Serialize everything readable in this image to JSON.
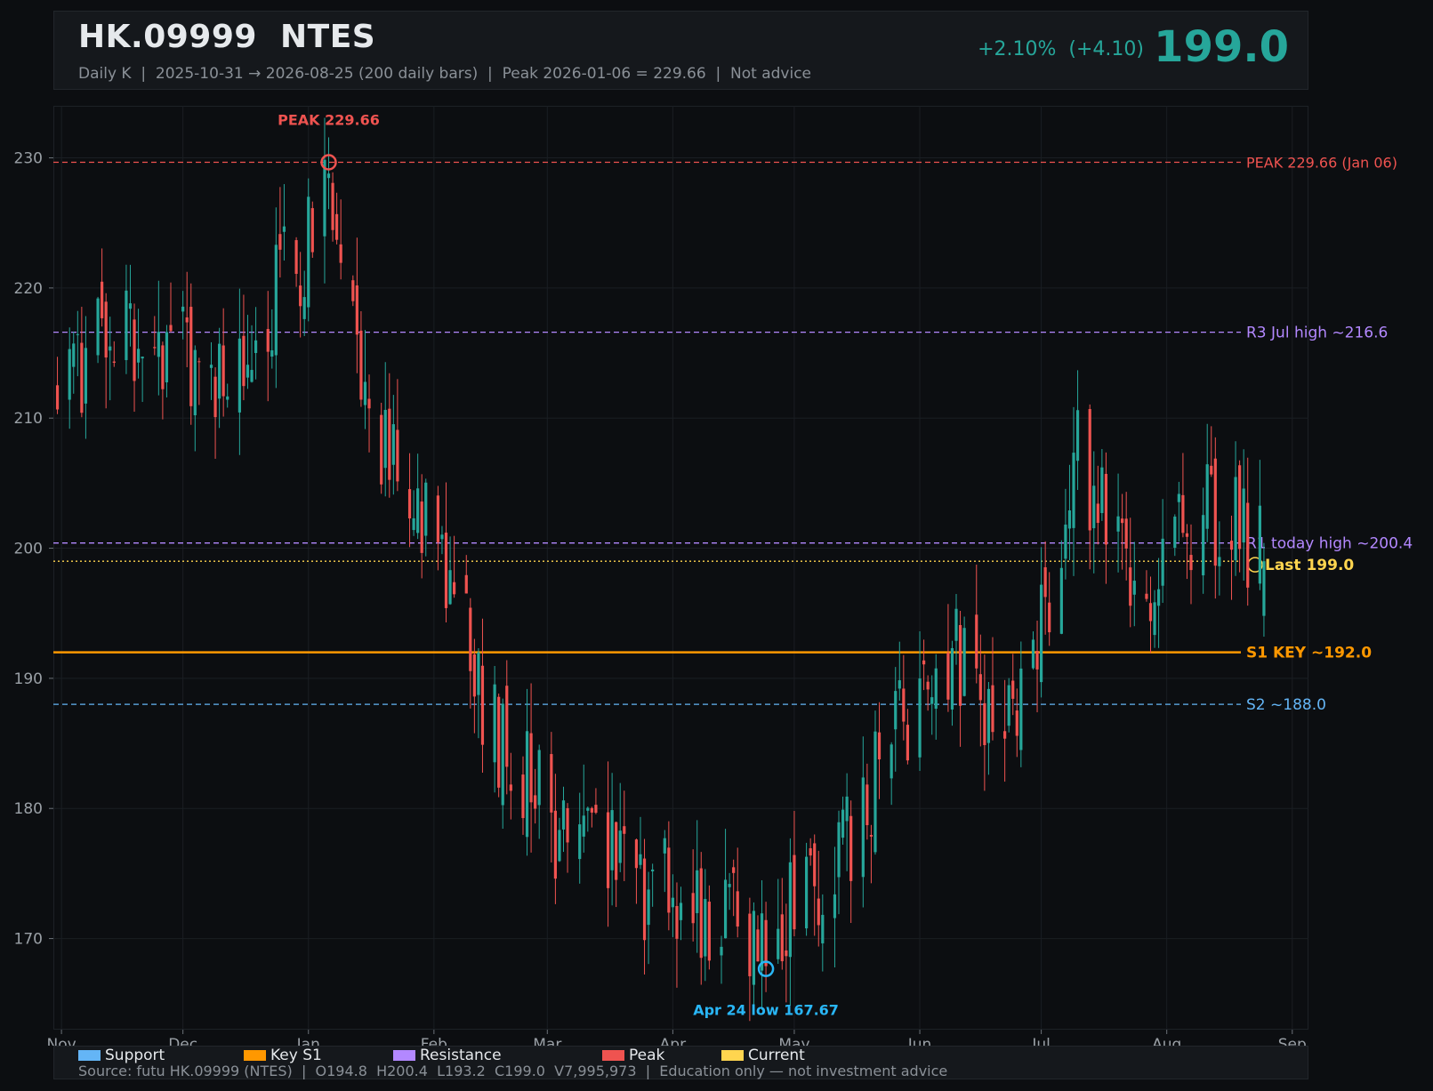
{
  "header": {
    "title": "HK.09999  NTES",
    "subtitle": "Daily K  |  2025-10-31 → 2026-08-25 (200 daily bars)  |  Peak 2026-01-06 = 229.66  |  Not advice",
    "change": "+2.10%  (+4.10)",
    "price": "199.0"
  },
  "colors": {
    "up": "#26a69a",
    "down": "#ef5350",
    "support": "#64b5f6",
    "key_s1": "#ff9800",
    "resistance": "#b388ff",
    "peak": "#ef5350",
    "current": "#ffd54f",
    "low_marker": "#29b6f6"
  },
  "chart_data": {
    "type": "candlestick",
    "ylim": [
      163,
      234
    ],
    "yticks": [
      170,
      180,
      190,
      200,
      210,
      220,
      230
    ],
    "xlim": [
      "2025-10-30",
      "2026-09-05"
    ],
    "month_ticks": [
      {
        "label": "Nov",
        "date": "2025-11-01"
      },
      {
        "label": "Dec",
        "date": "2025-12-01"
      },
      {
        "label": "Jan",
        "date": "2026-01-01"
      },
      {
        "label": "Feb",
        "date": "2026-02-01"
      },
      {
        "label": "Mar",
        "date": "2026-03-01"
      },
      {
        "label": "Apr",
        "date": "2026-04-01"
      },
      {
        "label": "May",
        "date": "2026-05-01"
      },
      {
        "label": "Jun",
        "date": "2026-06-01"
      },
      {
        "label": "Jul",
        "date": "2026-07-01"
      },
      {
        "label": "Aug",
        "date": "2026-08-01"
      },
      {
        "label": "Sep",
        "date": "2026-09-01"
      }
    ],
    "ohlc_anchors": [
      {
        "date": "2025-10-31",
        "close": 214
      },
      {
        "date": "2025-11-20",
        "close": 217
      },
      {
        "date": "2025-12-10",
        "close": 212
      },
      {
        "date": "2026-01-06",
        "close": 226
      },
      {
        "date": "2026-01-20",
        "close": 208
      },
      {
        "date": "2026-02-01",
        "close": 200
      },
      {
        "date": "2026-02-15",
        "close": 187
      },
      {
        "date": "2026-03-05",
        "close": 178
      },
      {
        "date": "2026-04-01",
        "close": 173
      },
      {
        "date": "2026-04-24",
        "close": 170
      },
      {
        "date": "2026-05-20",
        "close": 181
      },
      {
        "date": "2026-06-05",
        "close": 193
      },
      {
        "date": "2026-06-25",
        "close": 186
      },
      {
        "date": "2026-07-10",
        "close": 208
      },
      {
        "date": "2026-07-28",
        "close": 195
      },
      {
        "date": "2026-08-10",
        "close": 204
      },
      {
        "date": "2026-08-25",
        "close": 199
      }
    ],
    "last_bar": {
      "open": 194.8,
      "high": 200.4,
      "low": 193.2,
      "close": 199.0,
      "volume": "7,995,973"
    },
    "levels": [
      {
        "name": "peak",
        "value": 229.66,
        "label": "PEAK 229.66 (Jan 06)",
        "style": "dashed",
        "color": "#ef5350"
      },
      {
        "name": "r3",
        "value": 216.6,
        "label": "R3 Jul high ~216.6",
        "style": "dashed",
        "color": "#b388ff"
      },
      {
        "name": "r1",
        "value": 200.4,
        "label": "R1 today high ~200.4",
        "style": "dashed",
        "color": "#b388ff"
      },
      {
        "name": "last",
        "value": 199.0,
        "label": "Last 199.0",
        "style": "dotted",
        "color": "#ffd54f"
      },
      {
        "name": "s1",
        "value": 192.0,
        "label": "S1 KEY ~192.0",
        "style": "solid",
        "color": "#ff9800"
      },
      {
        "name": "s2",
        "value": 188.0,
        "label": "S2 ~188.0",
        "style": "dashed",
        "color": "#64b5f6"
      }
    ],
    "annotations": [
      {
        "name": "peak-marker",
        "date": "2026-01-06",
        "value": 229.66,
        "label": "PEAK 229.66",
        "color": "#ef5350"
      },
      {
        "name": "low-marker",
        "date": "2026-04-24",
        "value": 167.67,
        "label": "Apr 24 low 167.67",
        "color": "#29b6f6"
      }
    ],
    "legend": [
      {
        "label": "Support",
        "color": "#64b5f6"
      },
      {
        "label": "Key S1",
        "color": "#ff9800"
      },
      {
        "label": "Resistance",
        "color": "#b388ff"
      },
      {
        "label": "Peak",
        "color": "#ef5350"
      },
      {
        "label": "Current",
        "color": "#ffd54f"
      }
    ]
  },
  "footer": {
    "source": "Source: futu HK.09999 (NTES)  |  O194.8  H200.4  L193.2  C199.0  V7,995,973  |  Education only — not investment advice"
  }
}
